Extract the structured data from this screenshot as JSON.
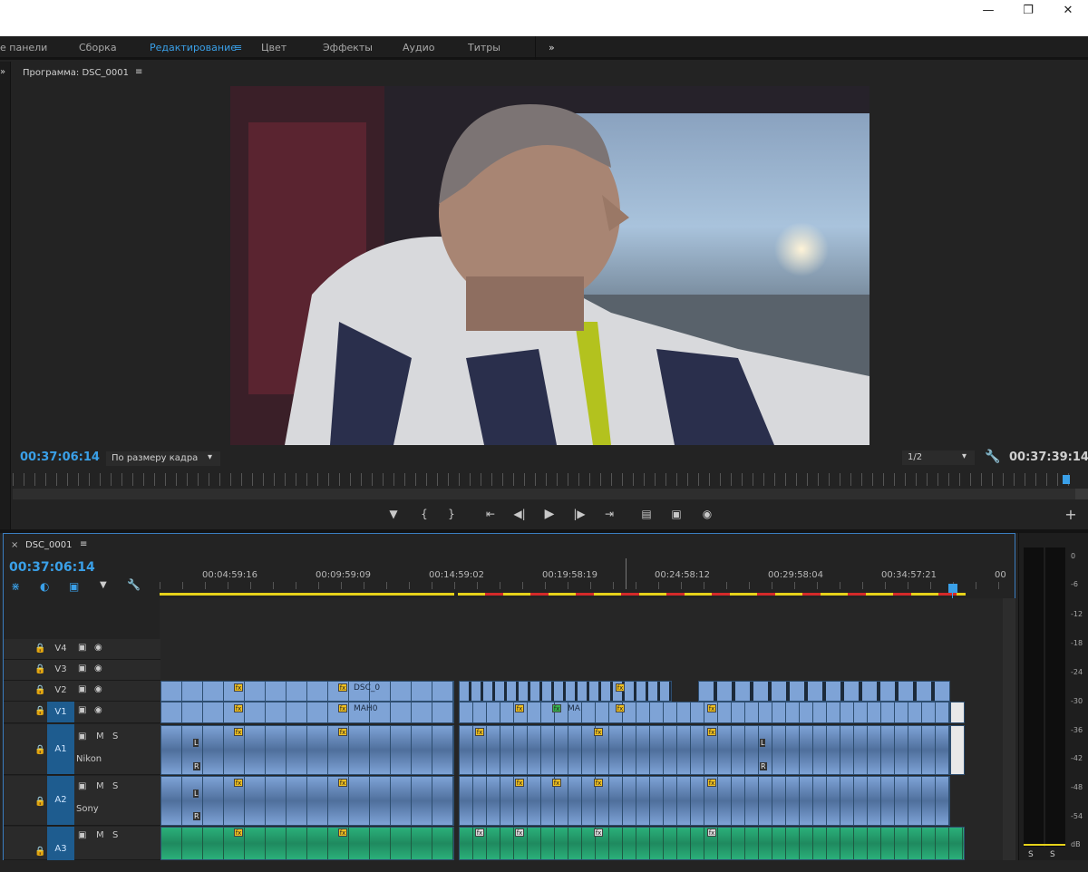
{
  "workspace": {
    "items": [
      "е панели",
      "Сборка",
      "Редактирование",
      "Цвет",
      "Эффекты",
      "Аудио",
      "Титры"
    ],
    "active_index": 2,
    "more": "»"
  },
  "program": {
    "title": "Программа: DSC_0001",
    "menu_icon": "≡",
    "timecode_in": "00:37:06:14",
    "timecode_out": "00:37:39:14",
    "zoom": "По размеру кадра",
    "resolution": "1/2"
  },
  "transport": {
    "icons": [
      "marker-icon",
      "mark-in-icon",
      "mark-out-icon",
      "go-to-in-icon",
      "step-back-icon",
      "play-icon",
      "step-forward-icon",
      "go-to-out-icon",
      "insert-icon",
      "overwrite-icon",
      "export-frame-icon"
    ],
    "add": "+"
  },
  "timeline": {
    "tab": "DSC_0001",
    "close": "×",
    "timecode": "00:37:06:14",
    "ruler": [
      "00:04:59:16",
      "00:09:59:09",
      "00:14:59:02",
      "00:19:58:19",
      "00:24:58:12",
      "00:29:58:04",
      "00:34:57:21",
      "00"
    ],
    "tracks": {
      "v4": "V4",
      "v3": "V3",
      "v2": "V2",
      "v1": "V1",
      "a1": "A1",
      "a1_name": "Nikon",
      "a2": "A2",
      "a2_name": "Sony",
      "a3": "A3"
    },
    "clip_labels": {
      "v2": "DSC_0",
      "v1": "МАН0",
      "v1b": "MA"
    },
    "m": "M",
    "s": "S",
    "l": "L",
    "r": "R",
    "fx": "fx"
  },
  "meter": {
    "scale": [
      "0",
      "-6",
      "-12",
      "-18",
      "-24",
      "-30",
      "-36",
      "-42",
      "-48",
      "-54",
      "dB"
    ],
    "bottom": [
      "S",
      "S"
    ]
  },
  "colors": {
    "accent": "#3aa0e8",
    "video_clip": "#7ea3d6",
    "audio_a3": "#2bb07a"
  }
}
